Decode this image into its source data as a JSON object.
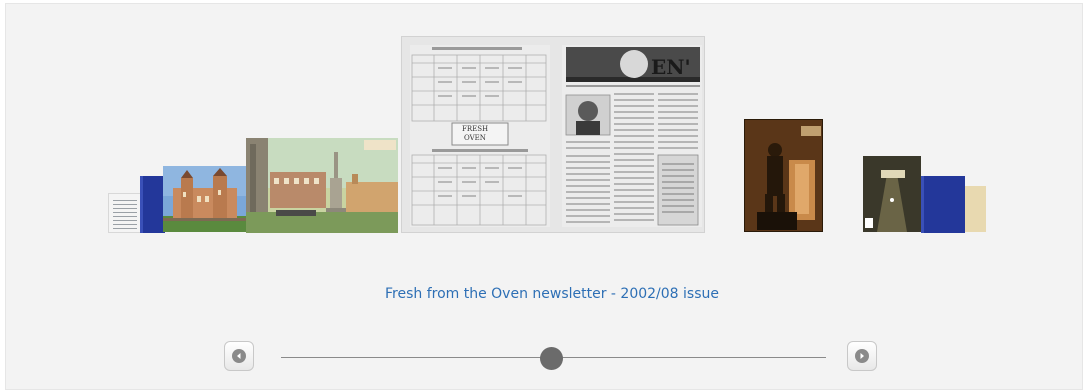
{
  "carousel": {
    "caption": "Fresh from the Oven newsletter - 2002/08 issue",
    "current_position_fraction": 0.5,
    "items": [
      {
        "name": "table-page"
      },
      {
        "name": "blue-cover"
      },
      {
        "name": "castle-postcard"
      },
      {
        "name": "monument-postcard"
      },
      {
        "name": "newsletter-spread",
        "header_text": "EN'",
        "mini_labels": [
          "FRESH",
          "OVEN"
        ]
      },
      {
        "name": "statue-photo"
      },
      {
        "name": "bowling-photo"
      },
      {
        "name": "blue-cover-2"
      },
      {
        "name": "cream-cover"
      }
    ]
  },
  "controls": {
    "prev_icon": "left-arrow-icon",
    "next_icon": "right-arrow-icon"
  },
  "colors": {
    "caption": "#2d6fb5",
    "background": "#f3f3f3",
    "slider_handle": "#6b6b6b"
  }
}
